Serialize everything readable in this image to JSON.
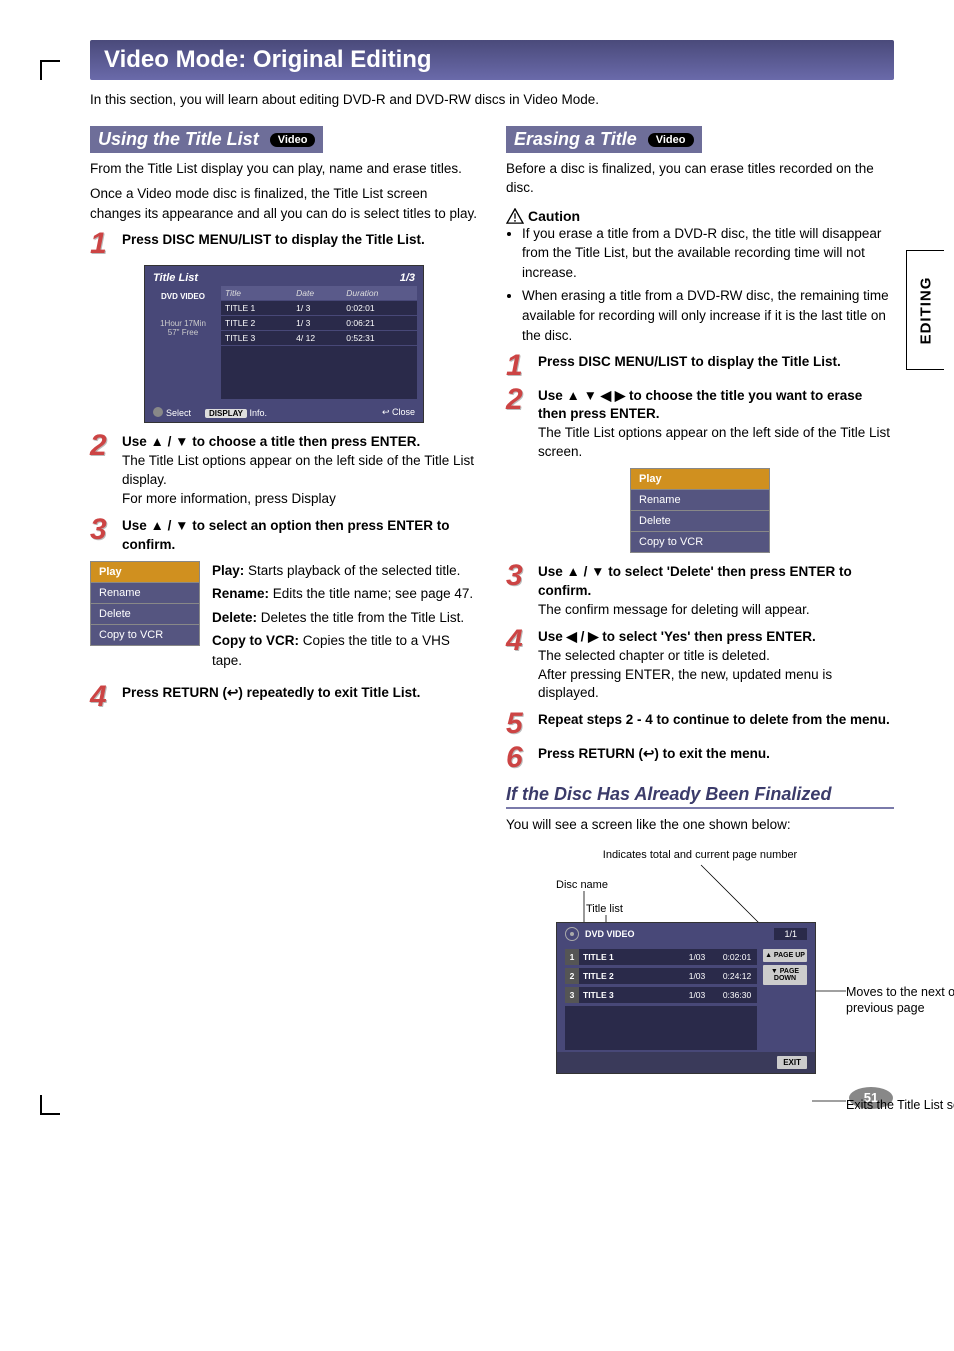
{
  "sideTab": "EDITING",
  "sectionBar": "Video Mode: Original Editing",
  "intro": "In this section, you will learn about editing DVD-R and DVD-RW discs in Video Mode.",
  "pill": "Video",
  "left": {
    "subhead": "Using the Title List",
    "para1": "From the Title List display you can play, name and erase titles.",
    "para2": "Once a Video mode disc is finalized, the Title List screen changes its appearance and all you can do is select titles to play.",
    "step1": "Press DISC MENU/LIST to display the Title List.",
    "titleListShot": {
      "heading": "Title List",
      "pageInd": "1/3",
      "sideType": "DVD VIDEO",
      "sideFree": "1Hour 17Min\n57\" Free",
      "cols": {
        "title": "Title",
        "date": "Date",
        "dur": "Duration"
      },
      "rows": [
        {
          "title": "TITLE 1",
          "date": "1/ 3",
          "dur": "0:02:01"
        },
        {
          "title": "TITLE 2",
          "date": "1/ 3",
          "dur": "0:06:21"
        },
        {
          "title": "TITLE 3",
          "date": "4/ 12",
          "dur": "0:52:31"
        }
      ],
      "footSelect": "Select",
      "footInfoBadge": "DISPLAY",
      "footInfo": "Info.",
      "footClose": "Close"
    },
    "step2lead": "Use ▲ / ▼ to choose a title then press ENTER.",
    "step2body": "The Title List options appear on the left side of the Title List display.",
    "step2extra": "For more information, press Display",
    "step3lead": "Use ▲ / ▼ to select an option then press ENTER to confirm.",
    "optMenu": [
      "Play",
      "Rename",
      "Delete",
      "Copy to VCR"
    ],
    "optDesc": {
      "play": "Play: Starts playback of the selected title.",
      "rename": "Rename: Edits the title name; see page 47.",
      "delete": "Delete: Deletes the title from the Title List.",
      "copy": "Copy to VCR: Copies the title to a VHS tape."
    },
    "step4": "Press RETURN (↩) repeatedly to exit Title List."
  },
  "right": {
    "eraseHead": "Erasing a Title",
    "erasePara": "Before a disc is finalized, you can erase titles recorded on the disc.",
    "cautionLabel": "Caution",
    "cautions": [
      "If you erase a title from a DVD-R disc, the title will disappear from the Title List, but the available recording time will not increase.",
      "When erasing a title from a DVD-RW disc, the remaining time available for recording will only increase if it is the last title on the disc."
    ],
    "step1": "Press DISC MENU/LIST to display the Title List.",
    "step2lead": "Use ▲ ▼ ◀ ▶ to choose the title you want to erase then press ENTER.",
    "step2body": "The Title List options appear on the left side of the Title List screen.",
    "optMenu": [
      "Play",
      "Rename",
      "Delete",
      "Copy to VCR"
    ],
    "step3lead": "Use ▲ / ▼ to select 'Delete' then press ENTER to confirm.",
    "step3body": "The confirm message for deleting will appear.",
    "step4lead": "Use ◀ / ▶ to select 'Yes' then press ENTER.",
    "step4body1": "The selected chapter or title is deleted.",
    "step4body2": "After pressing ENTER, the new, updated menu is displayed.",
    "step5lead": "Repeat steps 2 - 4 to continue to delete from the menu.",
    "step6": "Press RETURN (↩) to exit the menu.",
    "finalHead": "If the Disc Has Already Been Finalized",
    "finalBody": "You will see a screen like the one shown below:",
    "finalShot": {
      "topLabel": "Indicates total and current page number",
      "discName": "Disc name",
      "titleList": "Title list",
      "dv": "DVD VIDEO",
      "pg": "1/1",
      "rows": [
        {
          "n": "1",
          "t": "TITLE 1",
          "d": "1/03",
          "du": "0:02:01"
        },
        {
          "n": "2",
          "t": "TITLE 2",
          "d": "1/03",
          "du": "0:24:12"
        },
        {
          "n": "3",
          "t": "TITLE 3",
          "d": "1/03",
          "du": "0:36:30"
        }
      ],
      "pageUp": "▲ PAGE UP",
      "pageDown": "▼ PAGE DOWN",
      "exit": "EXIT",
      "calloutPages": "Moves to the next or previous page",
      "calloutExit": "Exits the Title List screen."
    }
  },
  "pageNumber": "51"
}
